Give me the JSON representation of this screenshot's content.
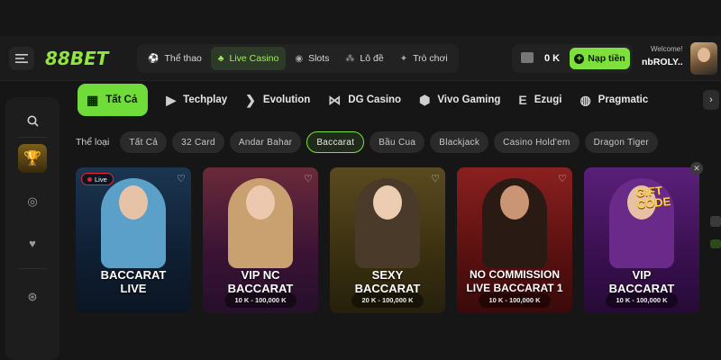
{
  "brand": {
    "logo_text": "88BET",
    "accent": "#7ee03c"
  },
  "header": {
    "nav": [
      {
        "label": "Thể thao",
        "icon": "soccer-ball-icon",
        "active": false
      },
      {
        "label": "Live Casino",
        "icon": "casino-table-icon",
        "active": true
      },
      {
        "label": "Slots",
        "icon": "slot-machine-icon",
        "active": false
      },
      {
        "label": "Lô đề",
        "icon": "lottery-balls-icon",
        "active": false
      },
      {
        "label": "Trò chơi",
        "icon": "gamepad-icon",
        "active": false
      }
    ],
    "wallet": {
      "balance": "0 K",
      "deposit_label": "Nạp tiền"
    },
    "user": {
      "welcome": "Welcome!",
      "name": "nbROLY.."
    }
  },
  "providers": [
    {
      "label": "Tất Cả",
      "icon": "grid-icon",
      "active": true
    },
    {
      "label": "Techplay",
      "icon": "techplay-icon",
      "active": false
    },
    {
      "label": "Evolution",
      "icon": "evolution-icon",
      "active": false
    },
    {
      "label": "DG Casino",
      "icon": "dg-wings-icon",
      "active": false
    },
    {
      "label": "Vivo Gaming",
      "icon": "vivo-cube-icon",
      "active": false
    },
    {
      "label": "Ezugi",
      "icon": "ezugi-icon",
      "active": false
    },
    {
      "label": "Pragmatic",
      "icon": "pragmatic-play-icon",
      "active": false
    }
  ],
  "categories": {
    "label": "Thể loại",
    "items": [
      {
        "label": "Tất Cả",
        "active": false
      },
      {
        "label": "32 Card",
        "active": false
      },
      {
        "label": "Andar Bahar",
        "active": false
      },
      {
        "label": "Baccarat",
        "active": true
      },
      {
        "label": "Bầu Cua",
        "active": false
      },
      {
        "label": "Blackjack",
        "active": false
      },
      {
        "label": "Casino Hold'em",
        "active": false
      },
      {
        "label": "Dragon Tiger",
        "active": false
      }
    ]
  },
  "games": [
    {
      "title_line1": "BACCARAT",
      "title_line2": "LIVE",
      "limit": "",
      "live_label": "Live",
      "theme": "#1e3a5a"
    },
    {
      "title_line1": "VIP NC",
      "title_line2": "BACCARAT",
      "limit": "10 K - 100,000 K",
      "theme": "#7a1f5a"
    },
    {
      "title_line1": "SEXY",
      "title_line2": "BACCARAT",
      "limit": "20 K - 100,000 K",
      "theme": "#6a5a1e"
    },
    {
      "title_line1": "NO COMMISSION",
      "title_line2": "LIVE BACCARAT 1",
      "limit": "10 K - 100,000 K",
      "theme": "#8a1a1a"
    },
    {
      "title_line1": "VIP",
      "title_line2": "BACCARAT",
      "limit": "10 K - 100,000 K",
      "theme": "#5a1f7a",
      "promo_line1": "GIFT",
      "promo_line2": "CODE"
    }
  ]
}
